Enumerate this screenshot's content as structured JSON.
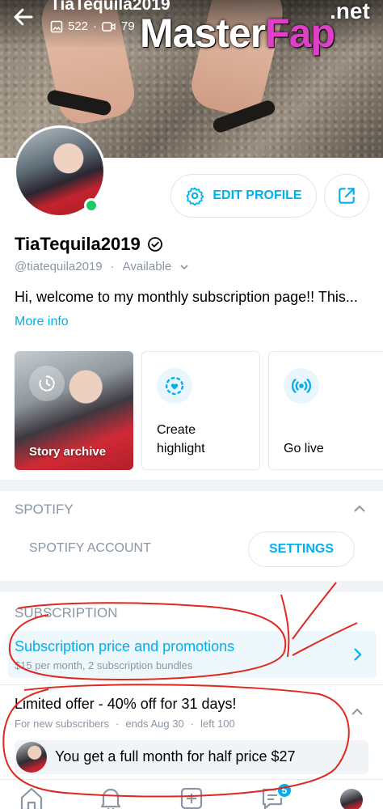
{
  "cover": {
    "name": "TiaTequila2019",
    "photos_count": "522",
    "videos_count": "79",
    "watermark_main": "Master",
    "watermark_accent": "Fap",
    "watermark_suffix": ".net"
  },
  "profile": {
    "edit_label": "EDIT PROFILE",
    "name": "TiaTequila2019",
    "handle": "@tiatequila2019",
    "status": "Available",
    "bio": "Hi, welcome to my monthly subscription page!! This...",
    "more_info": "More info"
  },
  "tiles": {
    "story_archive": "Story archive",
    "create_highlight_line1": "Create",
    "create_highlight_line2": "highlight",
    "go_live": "Go live"
  },
  "spotify": {
    "heading": "SPOTIFY",
    "account_label": "SPOTIFY ACCOUNT",
    "settings_label": "SETTINGS"
  },
  "subscription": {
    "heading": "SUBSCRIPTION",
    "title": "Subscription price and promotions",
    "description": "$15 per month, 2 subscription bundles"
  },
  "offer": {
    "title": "Limited offer - 40% off for 31 days!",
    "audience": "For new subscribers",
    "ends": "ends Aug 30",
    "left": "left 100",
    "message": "You get a full month for half price $27"
  },
  "bottom_nav": {
    "messages_badge": "5"
  },
  "colors": {
    "accent": "#00aff0",
    "muted": "#8a96a3",
    "online": "#1fc766",
    "annotation_red": "#e0281e"
  }
}
